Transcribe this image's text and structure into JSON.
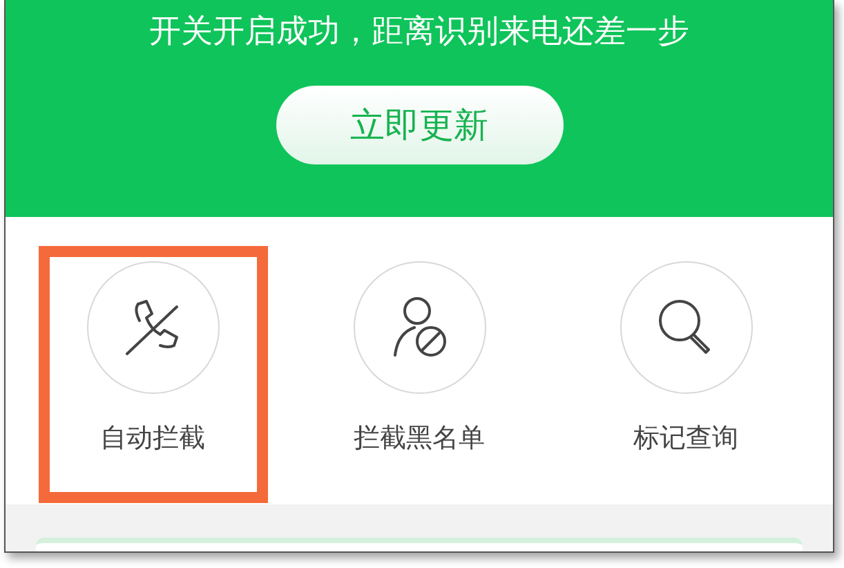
{
  "banner": {
    "message": "开关开启成功，距离识别来电还差一步",
    "button": "立即更新"
  },
  "features": [
    {
      "kind": "phone-off",
      "label": "自动拦截",
      "highlighted": true
    },
    {
      "kind": "person-block",
      "label": "拦截黑名单",
      "highlighted": false
    },
    {
      "kind": "search",
      "label": "标记查询",
      "highlighted": false
    }
  ]
}
